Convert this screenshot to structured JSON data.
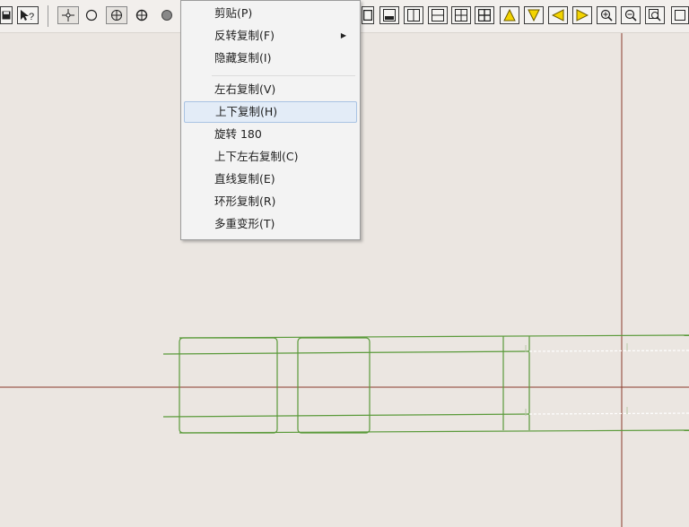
{
  "toolbar": {
    "left_icons": [
      "save-icon",
      "help-pointer-icon"
    ],
    "snap_icons": [
      "crosshair-point-icon",
      "circle-icon",
      "circle-cross-icon",
      "target-icon",
      "filled-dot-icon"
    ],
    "right_icons": [
      "frame-icon",
      "frame-bottom-icon",
      "vsplit-icon",
      "hsplit-icon",
      "quad-icon",
      "grid-icon",
      "triangle-up-icon",
      "triangle-down-icon",
      "triangle-left-icon",
      "triangle-right-icon",
      "zoom-in-icon",
      "zoom-out-icon",
      "zoom-window-icon",
      "square-icon"
    ]
  },
  "context_menu": {
    "items": [
      {
        "label": "剪贴(P)",
        "submenu": false
      },
      {
        "label": "反转复制(F)",
        "submenu": true
      },
      {
        "label": "隐藏复制(I)",
        "submenu": false
      },
      {
        "label": "左右复制(V)",
        "submenu": false
      },
      {
        "label": "上下复制(H)",
        "submenu": false,
        "highlighted": true
      },
      {
        "label": "旋转 180",
        "submenu": false
      },
      {
        "label": "上下左右复制(C)",
        "submenu": false
      },
      {
        "label": "直线复制(E)",
        "submenu": false
      },
      {
        "label": "环形复制(R)",
        "submenu": false
      },
      {
        "label": "多重变形(T)",
        "submenu": false
      }
    ]
  },
  "colors": {
    "canvas": "#ebe6e1",
    "guide_line": "#8a3b2a",
    "pattern_line": "#5a9a3a",
    "highlight": "#e3ecf7"
  }
}
